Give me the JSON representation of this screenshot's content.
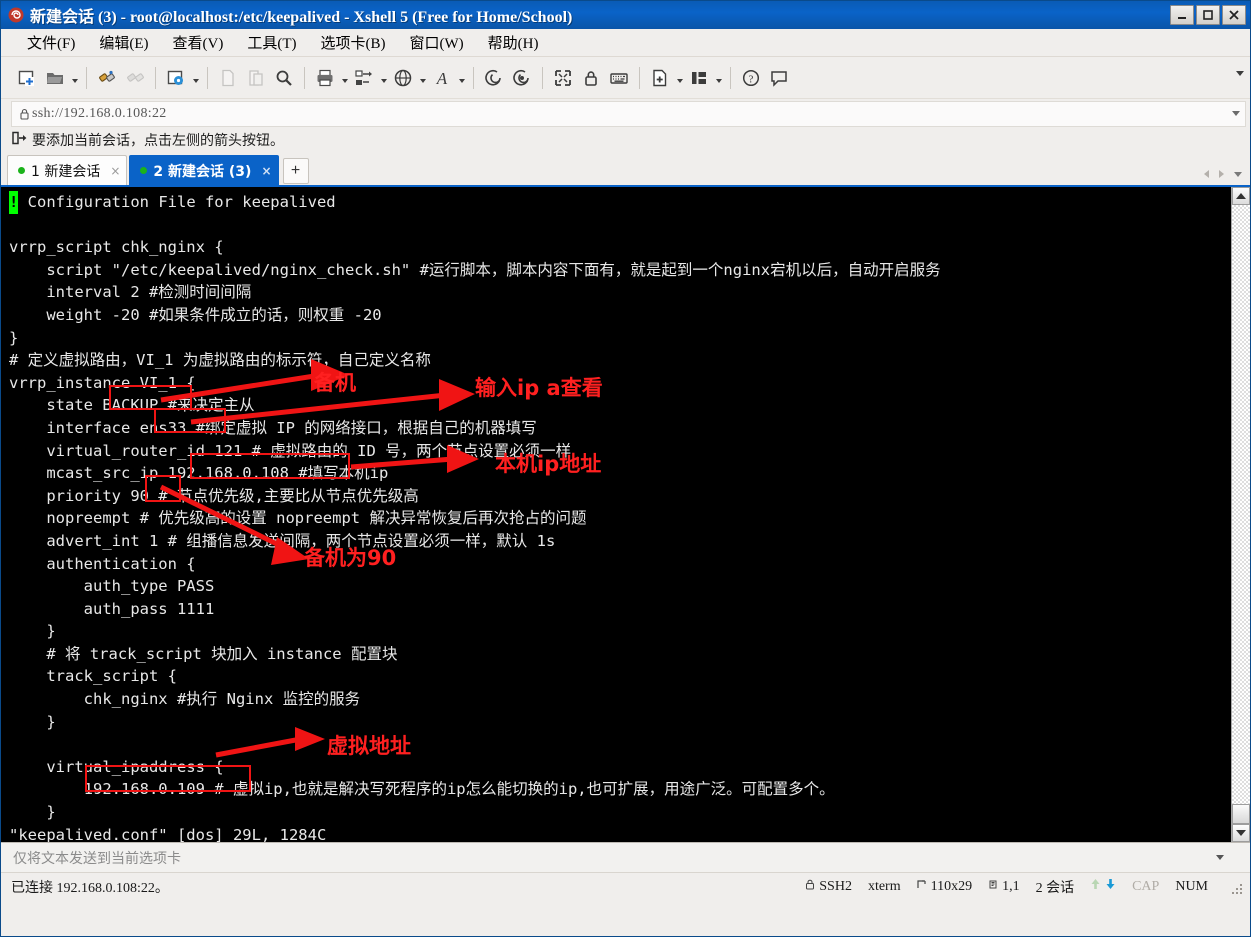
{
  "window": {
    "title": "新建会话 (3) - root@localhost:/etc/keepalived - Xshell 5 (Free for Home/School)",
    "minimize_label": "—",
    "maximize_label": "▢",
    "close_label": "✕",
    "app_icon": "xshell-icon"
  },
  "menu": {
    "items": [
      {
        "label": "文件(F)",
        "name": "menu-file"
      },
      {
        "label": "编辑(E)",
        "name": "menu-edit"
      },
      {
        "label": "查看(V)",
        "name": "menu-view"
      },
      {
        "label": "工具(T)",
        "name": "menu-tools"
      },
      {
        "label": "选项卡(B)",
        "name": "menu-tabs"
      },
      {
        "label": "窗口(W)",
        "name": "menu-window"
      },
      {
        "label": "帮助(H)",
        "name": "menu-help"
      }
    ]
  },
  "toolbar": {
    "icons": [
      "new-session-icon",
      "open-folder-icon",
      "connect-icon",
      "disconnect-icon",
      "session-properties-icon",
      "copy-icon",
      "paste-icon",
      "find-icon",
      "print-icon",
      "transfer-icon",
      "browser-icon",
      "font-icon",
      "log-icon",
      "record-icon",
      "fullscreen-icon",
      "lock-icon",
      "keyboard-icon",
      "new-tab-icon",
      "layout-icon",
      "help-icon",
      "comment-icon"
    ],
    "overflow_label": "▾"
  },
  "address": {
    "value": "ssh://192.168.0.108:22",
    "lock_icon": "lock-icon",
    "dropdown_label": "▾"
  },
  "hint": {
    "icon": "arrow-into-box-icon",
    "text": "要添加当前会话，点击左侧的箭头按钮。"
  },
  "tabs": {
    "items": [
      {
        "label": "1 新建会话",
        "active": false,
        "close_label": "×"
      },
      {
        "label": "2 新建会话 (3)",
        "active": true,
        "close_label": "×"
      }
    ],
    "add_label": "+",
    "nav_prev": "◀",
    "nav_next": "▶",
    "nav_list": "▾"
  },
  "terminal": {
    "cursor_char": "!",
    "lines": [
      " Configuration File for keepalived",
      "",
      "vrrp_script chk_nginx {",
      "    script \"/etc/keepalived/nginx_check.sh\" #运行脚本，脚本内容下面有，就是起到一个nginx宕机以后，自动开启服务",
      "    interval 2 #检测时间间隔",
      "    weight -20 #如果条件成立的话，则权重 -20",
      "}",
      "# 定义虚拟路由，VI_1 为虚拟路由的标示符，自己定义名称",
      "vrrp_instance VI_1 {",
      "    state BACKUP #来决定主从",
      "    interface ens33 #绑定虚拟 IP 的网络接口，根据自己的机器填写",
      "    virtual_router_id 121 # 虚拟路由的 ID 号，两个节点设置必须一样",
      "    mcast_src_ip 192.168.0.108 #填写本机ip",
      "    priority 90 # 节点优先级,主要比从节点优先级高",
      "    nopreempt # 优先级高的设置 nopreempt 解决异常恢复后再次抢占的问题",
      "    advert_int 1 # 组播信息发送间隔，两个节点设置必须一样，默认 1s",
      "    authentication {",
      "        auth_type PASS",
      "        auth_pass 1111",
      "    }",
      "    # 将 track_script 块加入 instance 配置块",
      "    track_script {",
      "        chk_nginx #执行 Nginx 监控的服务",
      "    }",
      "",
      "    virtual_ipaddress {",
      "        192.168.0.109 # 虚拟ip,也就是解决写死程序的ip怎么能切换的ip,也可扩展，用途广泛。可配置多个。",
      "    }",
      "\"keepalived.conf\" [dos] 29L, 1284C"
    ],
    "annotations": {
      "color": "#ff2020",
      "boxes": [
        {
          "name": "highlight-state-backup",
          "value": "BACKUP"
        },
        {
          "name": "highlight-interface-ens33",
          "value": "ens33"
        },
        {
          "name": "highlight-mcast-src-ip",
          "value": "192.168.0.108"
        },
        {
          "name": "highlight-priority",
          "value": "90"
        },
        {
          "name": "highlight-virtual-ip",
          "value": "192.168.0.109"
        }
      ],
      "labels": [
        {
          "name": "annotation-backup",
          "text": "备机"
        },
        {
          "name": "annotation-ip-a",
          "text": "输入ip a查看"
        },
        {
          "name": "annotation-local-ip",
          "text": "本机ip地址"
        },
        {
          "name": "annotation-backup-90",
          "text": "备机为90"
        },
        {
          "name": "annotation-virtual-address",
          "text": "虚拟地址"
        }
      ]
    }
  },
  "sendbar": {
    "text": "仅将文本发送到当前选项卡",
    "dropdown_label": "▾"
  },
  "statusbar": {
    "connection": "已连接 192.168.0.108:22。",
    "protocol": "SSH2",
    "term_type": "xterm",
    "size": "110x29",
    "cursor": "1,1",
    "sessions": "2 会话",
    "cap": "CAP",
    "num": "NUM",
    "upload_icon": "upload-arrow-icon",
    "download_icon": "download-arrow-icon",
    "protocol_icon": "lock-icon",
    "size_icon": "resize-icon",
    "cursor_icon": "cursor-icon"
  }
}
